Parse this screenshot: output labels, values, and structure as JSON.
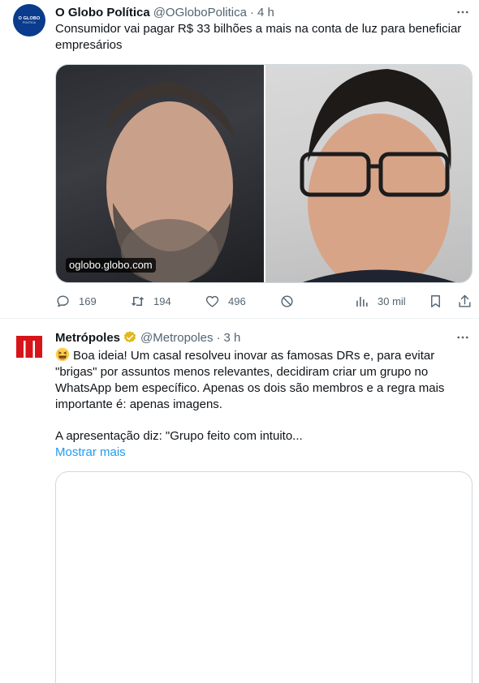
{
  "tweets": [
    {
      "avatar": {
        "line1": "O GLOBO",
        "line2": "POLÍTICA",
        "color": "#0a3b8c"
      },
      "name": "O Globo Política",
      "handle": "@OGloboPolitica",
      "separator": "·",
      "time": "4 h",
      "text": "Consumidor vai pagar R$ 33 bilhões a mais na conta de luz para beneficiar empresários",
      "media": {
        "link_label": "oglobo.globo.com"
      },
      "actions": {
        "replies": "169",
        "reposts": "194",
        "likes": "496",
        "views": "30 mil"
      }
    },
    {
      "avatar": {
        "icon": "metropoles-logo-icon",
        "color": "#d8141b"
      },
      "name": "Metrópoles",
      "verified_color": "#e2b719",
      "handle": "@Metropoles",
      "separator": "·",
      "time": "3 h",
      "text_p1": "Boa ideia! Um casal resolveu inovar as famosas DRs e, para evitar \"brigas\" por assuntos menos relevantes, decidiram criar um grupo no WhatsApp bem específico. Apenas os dois são membros e a regra mais importante é: apenas imagens.",
      "text_p2": "A apresentação diz: \"Grupo feito com intuito...",
      "show_more": "Mostrar mais"
    }
  ],
  "colors": {
    "link": "#1d9bf0",
    "secondary": "#536471",
    "border": "#cfd9de"
  }
}
